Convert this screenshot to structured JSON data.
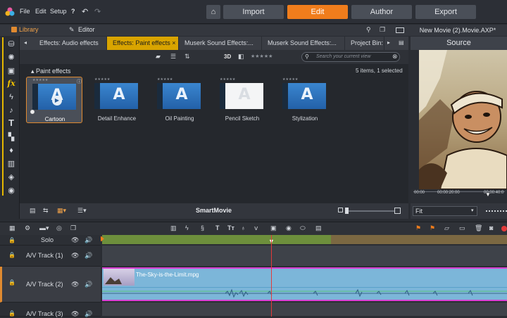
{
  "menu": {
    "file": "File",
    "edit": "Edit",
    "setup": "Setup",
    "help": "?"
  },
  "modes": {
    "import": "Import",
    "edit": "Edit",
    "author": "Author",
    "export": "Export"
  },
  "panels": {
    "library": "Library",
    "editor": "Editor"
  },
  "tabs": [
    {
      "label": "Effects: Audio effects"
    },
    {
      "label": "Effects: Paint effects ×"
    },
    {
      "label": "Muserk Sound Effects:..."
    },
    {
      "label": "Muserk Sound Effects:..."
    },
    {
      "label": "Project Bin:"
    }
  ],
  "toolbar": {
    "three_d": "3D",
    "search_placeholder": "Search your current view"
  },
  "library": {
    "section": "Paint effects",
    "count": "5 items, 1 selected",
    "items": [
      {
        "label": "Cartoon",
        "selected": true
      },
      {
        "label": "Detail Enhance"
      },
      {
        "label": "Oil Painting"
      },
      {
        "label": "Pencil Sketch"
      },
      {
        "label": "Stylization"
      }
    ],
    "glyph": "A",
    "stars": "★★★★★",
    "smartmovie": "SmartMovie"
  },
  "preview": {
    "title": "New Movie (2).Movie.AXP*",
    "tab": "Source",
    "times": [
      "00:00",
      "00:00:20:00",
      "00:00:40:0"
    ],
    "fit": "Fit"
  },
  "timeline": {
    "solo": "Solo",
    "tracks": [
      "A/V Track (1)",
      "A/V Track (2)",
      "A/V Track (3)"
    ],
    "clip_name": "The-Sky-is-the-Limit.mpg"
  },
  "colors": {
    "accent": "#f07d1c",
    "tab_active": "#d9a400",
    "clip": "#7cb6d9",
    "clip_border": "#d93fd3"
  }
}
